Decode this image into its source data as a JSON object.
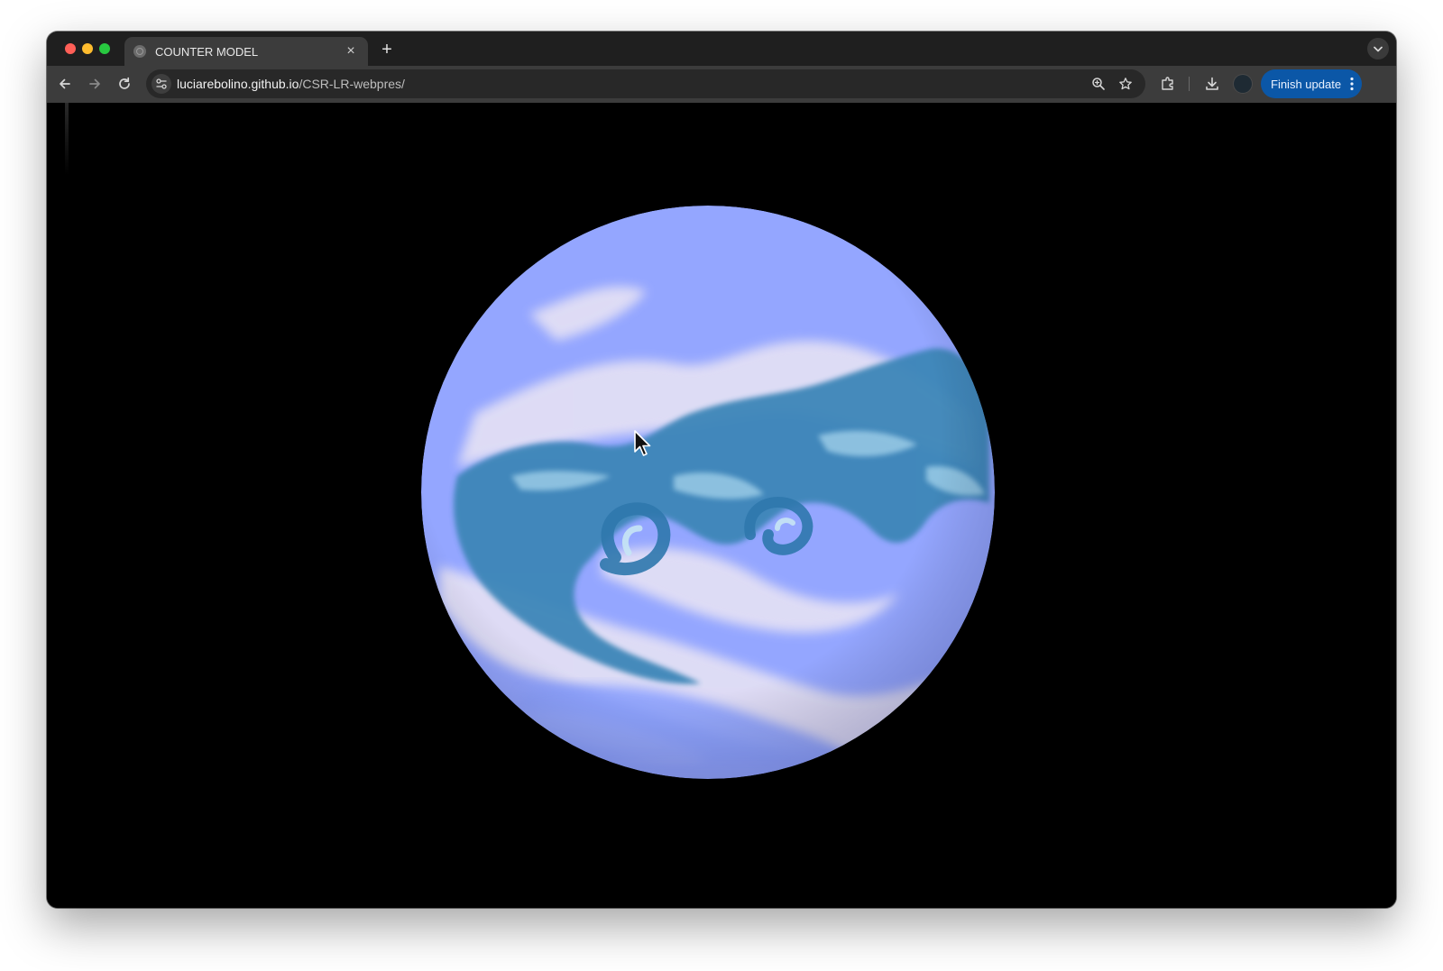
{
  "browser": {
    "tab": {
      "title": "COUNTER MODEL",
      "favicon": "globe-icon"
    },
    "address_bar": {
      "host": "luciarebolino.github.io",
      "path": "/CSR-LR-webpres/"
    },
    "update_button": {
      "label": "Finish update"
    }
  },
  "globe": {
    "ocean_color": "#94a6ff",
    "vapor_color": "#3d86b8",
    "cloud_color": "#e6e2f4"
  }
}
